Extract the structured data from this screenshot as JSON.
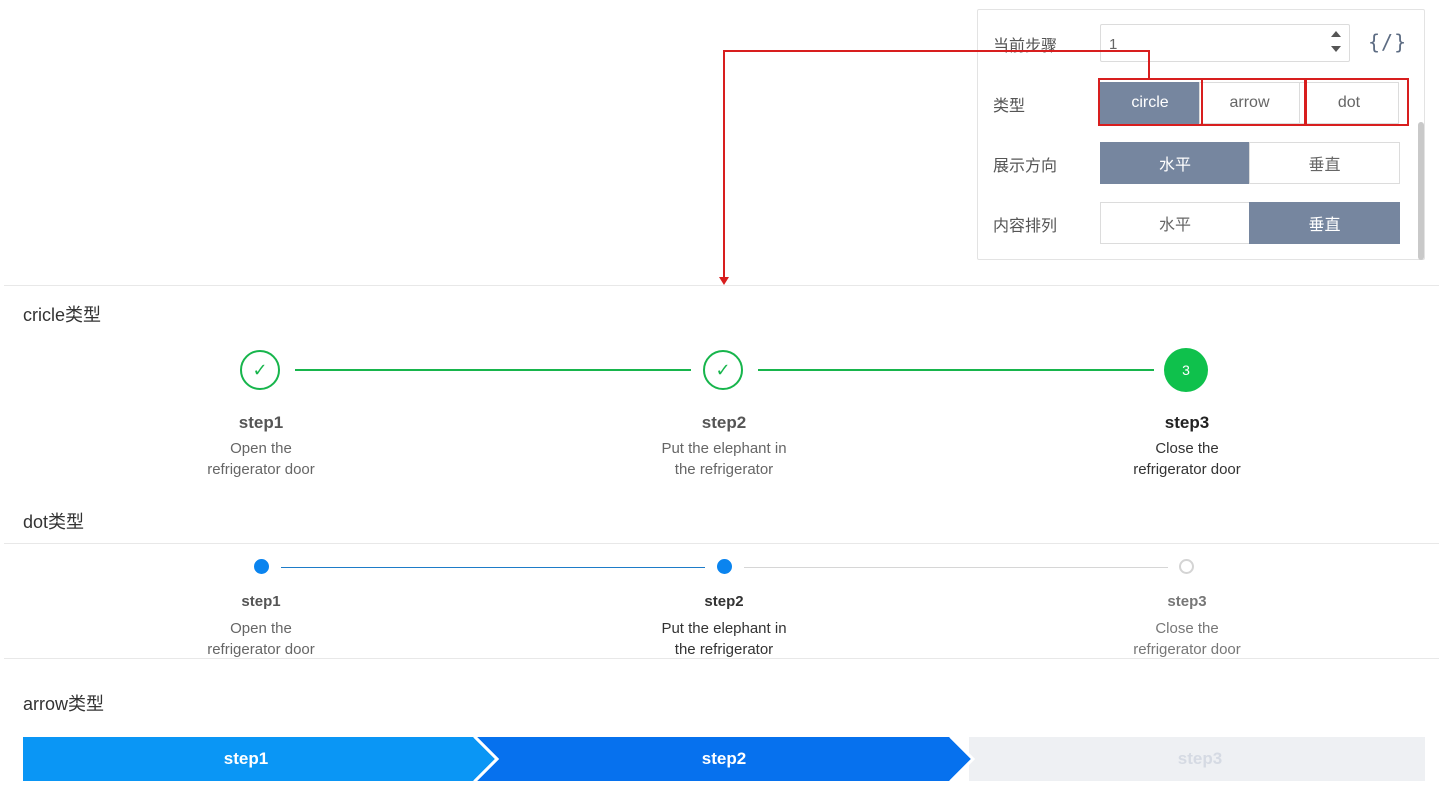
{
  "panel": {
    "current_step_label": "当前步骤",
    "current_step_value": "1",
    "code_icon": "{/}",
    "type_label": "类型",
    "type_options": [
      "circle",
      "arrow",
      "dot"
    ],
    "type_selected": "circle",
    "direction_label": "展示方向",
    "direction_options": [
      "水平",
      "垂直"
    ],
    "direction_selected": "水平",
    "content_label": "内容排列",
    "content_options": [
      "水平",
      "垂直"
    ],
    "content_selected": "垂直",
    "icons": {
      "spinner": "number-spinner-icon",
      "code": "code-toggle-icon"
    },
    "active_color": "#76869f",
    "highlight_color": "#d81e1e"
  },
  "circle_section": {
    "title": "cricle类型",
    "steps": [
      {
        "title": "step1",
        "desc_line1": "Open the",
        "desc_line2": "refrigerator door",
        "status": "done",
        "icon": "✓"
      },
      {
        "title": "step2",
        "desc_line1": "Put the elephant in",
        "desc_line2": "the refrigerator",
        "status": "done",
        "icon": "✓"
      },
      {
        "title": "step3",
        "desc_line1": "Close the",
        "desc_line2": "refrigerator door",
        "status": "current",
        "icon": "3"
      }
    ],
    "color": "#17b54c"
  },
  "dot_section": {
    "title": "dot类型",
    "steps": [
      {
        "title": "step1",
        "desc_line1": "Open the",
        "desc_line2": "refrigerator door",
        "status": "done"
      },
      {
        "title": "step2",
        "desc_line1": "Put the elephant in",
        "desc_line2": "the refrigerator",
        "status": "done"
      },
      {
        "title": "step3",
        "desc_line1": "Close the",
        "desc_line2": "refrigerator door",
        "status": "todo"
      }
    ],
    "color": "#0a84ef"
  },
  "arrow_section": {
    "title": "arrow类型",
    "steps": [
      {
        "title": "step1",
        "status": "done"
      },
      {
        "title": "step2",
        "status": "current"
      },
      {
        "title": "step3",
        "status": "todo"
      }
    ],
    "colors": {
      "done": "#0a96f5",
      "current": "#0671ee",
      "todo": "#eef0f3"
    }
  }
}
